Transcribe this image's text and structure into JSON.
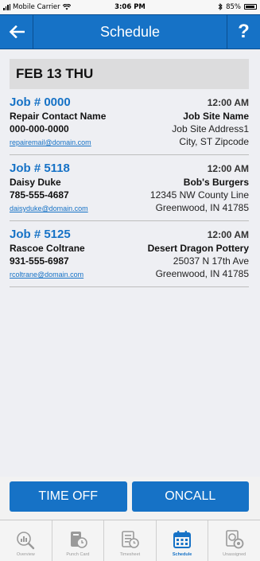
{
  "status": {
    "carrier": "Mobile Carrier",
    "time": "3:06 PM",
    "battery": "85%"
  },
  "header": {
    "title": "Schedule",
    "help_label": "?"
  },
  "date_bar": "FEB 13 THU",
  "jobs": [
    {
      "number": "Job # 0000",
      "time": "12:00 AM",
      "contact_name": "Repair Contact Name",
      "site_name": "Job Site Name",
      "phone": "000-000-0000",
      "address1": "Job Site Address1",
      "email": "repairemail@domain.com",
      "address2": "City, ST Zipcode"
    },
    {
      "number": "Job # 5118",
      "time": "12:00 AM",
      "contact_name": "Daisy Duke",
      "site_name": "Bob's Burgers",
      "phone": "785-555-4687",
      "address1": "12345 NW County Line",
      "email": "daisyduke@domain.com",
      "address2": "Greenwood, IN 41785"
    },
    {
      "number": "Job # 5125",
      "time": "12:00 AM",
      "contact_name": "Rascoe Coltrane",
      "site_name": "Desert Dragon Pottery",
      "phone": "931-555-6987",
      "address1": "25037 N 17th Ave",
      "email": "rcoltrane@domain.com",
      "address2": "Greenwood, IN 41785"
    }
  ],
  "actions": {
    "time_off": "TIME OFF",
    "oncall": "ONCALL"
  },
  "tabs": [
    {
      "label": "Overview",
      "icon": "overview-chart-icon"
    },
    {
      "label": "Punch Card",
      "icon": "punch-card-icon"
    },
    {
      "label": "Timesheet",
      "icon": "timesheet-icon"
    },
    {
      "label": "Schedule",
      "icon": "calendar-icon",
      "active": true
    },
    {
      "label": "Unassigned",
      "icon": "unassigned-gears-icon"
    }
  ],
  "colors": {
    "primary": "#1672c6",
    "background": "#eeeff3",
    "date_bar": "#dcdcdd"
  }
}
